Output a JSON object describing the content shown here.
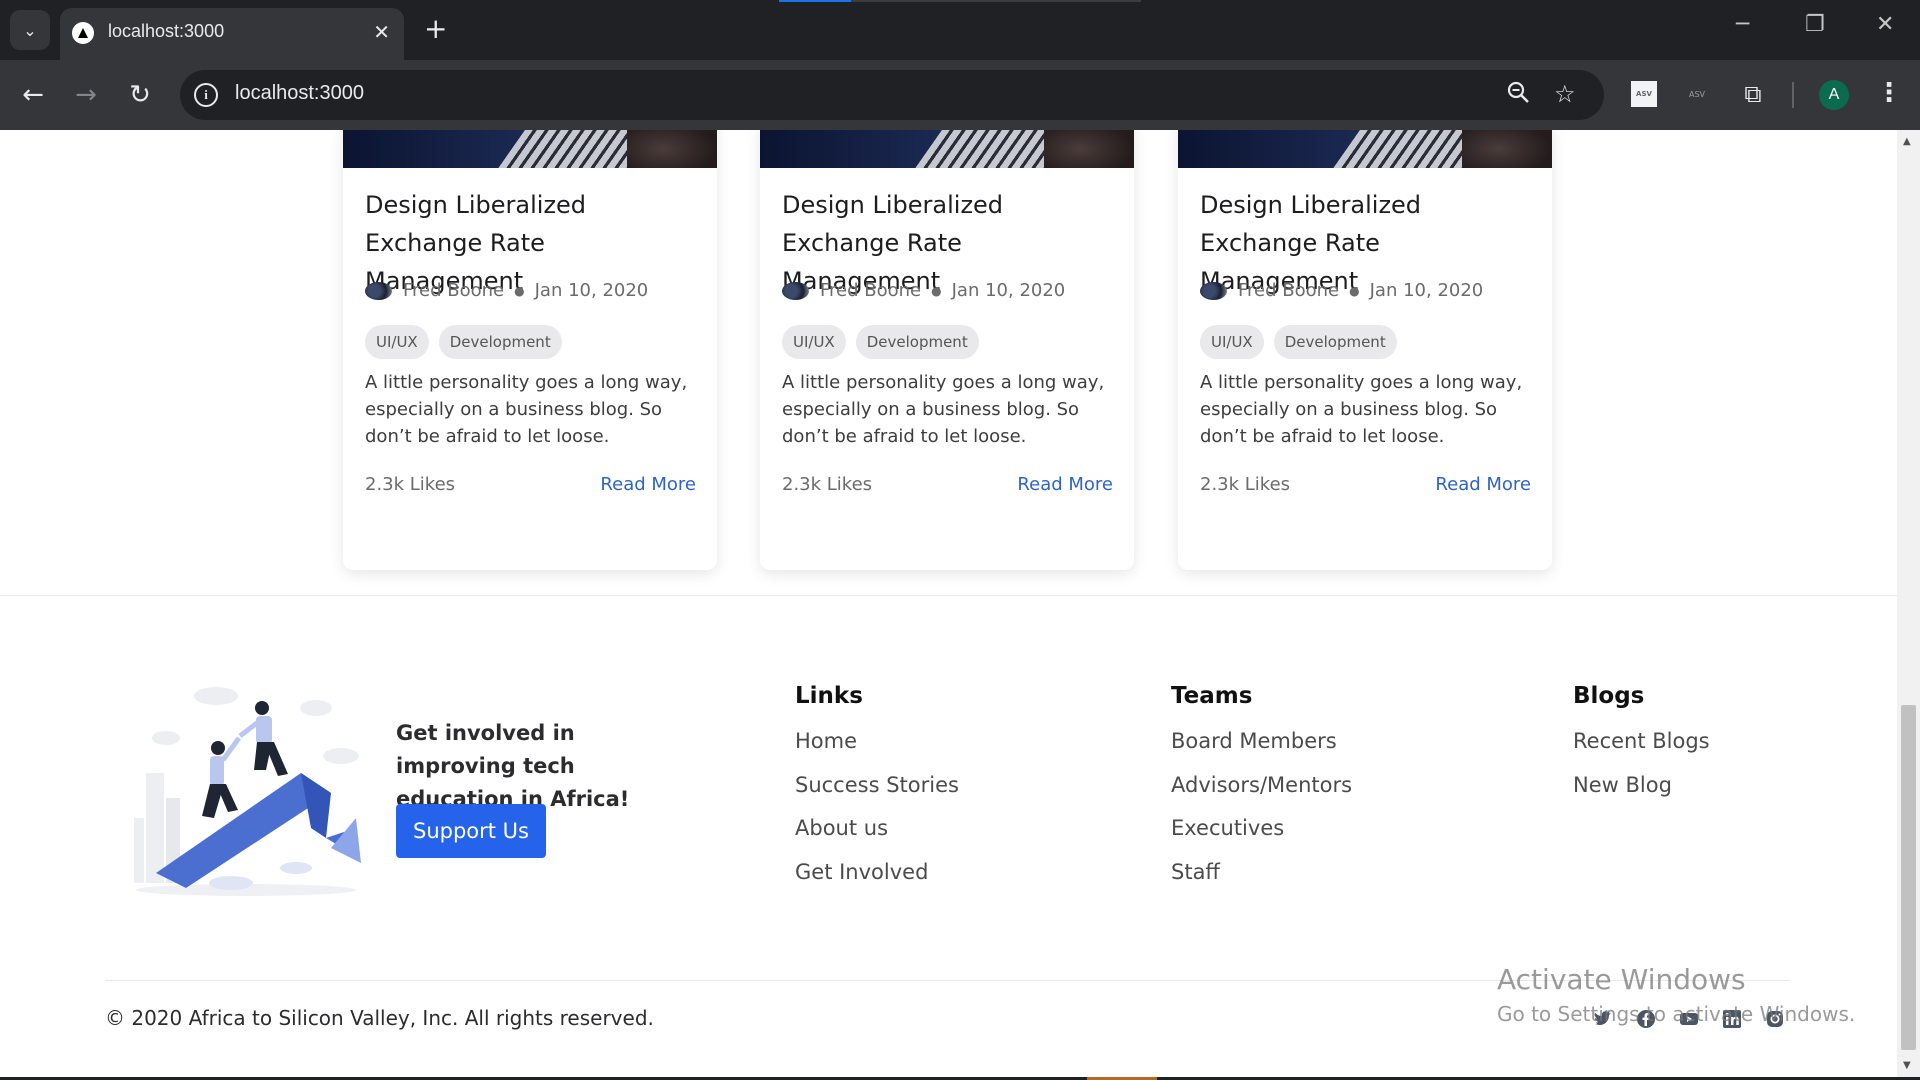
{
  "browser": {
    "tab_title": "localhost:3000",
    "url": "localhost:3000",
    "accent_color": "#1a73e8",
    "profile_initial": "A",
    "extension_1_label": "ASV",
    "extension_2_label": "ASV"
  },
  "cards": [
    {
      "title": "Design Liberalized Exchange Rate Management",
      "author": "Fred Boone",
      "date": "Jan 10, 2020",
      "tags": [
        "UI/UX",
        "Development"
      ],
      "excerpt": "A little personality goes a long way, especially on a business blog. So don’t be afraid to let loose.",
      "likes": "2.3k Likes",
      "read_more": "Read More"
    },
    {
      "title": "Design Liberalized Exchange Rate Management",
      "author": "Fred Boone",
      "date": "Jan 10, 2020",
      "tags": [
        "UI/UX",
        "Development"
      ],
      "excerpt": "A little personality goes a long way, especially on a business blog. So don’t be afraid to let loose.",
      "likes": "2.3k Likes",
      "read_more": "Read More"
    },
    {
      "title": "Design Liberalized Exchange Rate Management",
      "author": "Fred Boone",
      "date": "Jan 10, 2020",
      "tags": [
        "UI/UX",
        "Development"
      ],
      "excerpt": "A little personality goes a long way, especially on a business blog. So don’t be afraid to let loose.",
      "likes": "2.3k Likes",
      "read_more": "Read More"
    }
  ],
  "footer": {
    "cta_heading": "Get involved in improving tech education in Africa!",
    "support_button": "Support Us",
    "primary_color": "#2563eb",
    "columns": [
      {
        "heading": "Links",
        "items": [
          "Home",
          "Success Stories",
          "About us",
          "Get Involved"
        ]
      },
      {
        "heading": "Teams",
        "items": [
          "Board Members",
          "Advisors/Mentors",
          "Executives",
          "Staff"
        ]
      },
      {
        "heading": "Blogs",
        "items": [
          "Recent Blogs",
          "New Blog"
        ]
      }
    ],
    "copyright": "© 2020 Africa to Silicon Valley, Inc. All rights reserved.",
    "socials": [
      "twitter-icon",
      "facebook-icon",
      "youtube-icon",
      "linkedin-icon",
      "instagram-icon"
    ]
  },
  "windows_watermark": {
    "line1": "Activate Windows",
    "line2": "Go to Settings to activate Windows."
  }
}
